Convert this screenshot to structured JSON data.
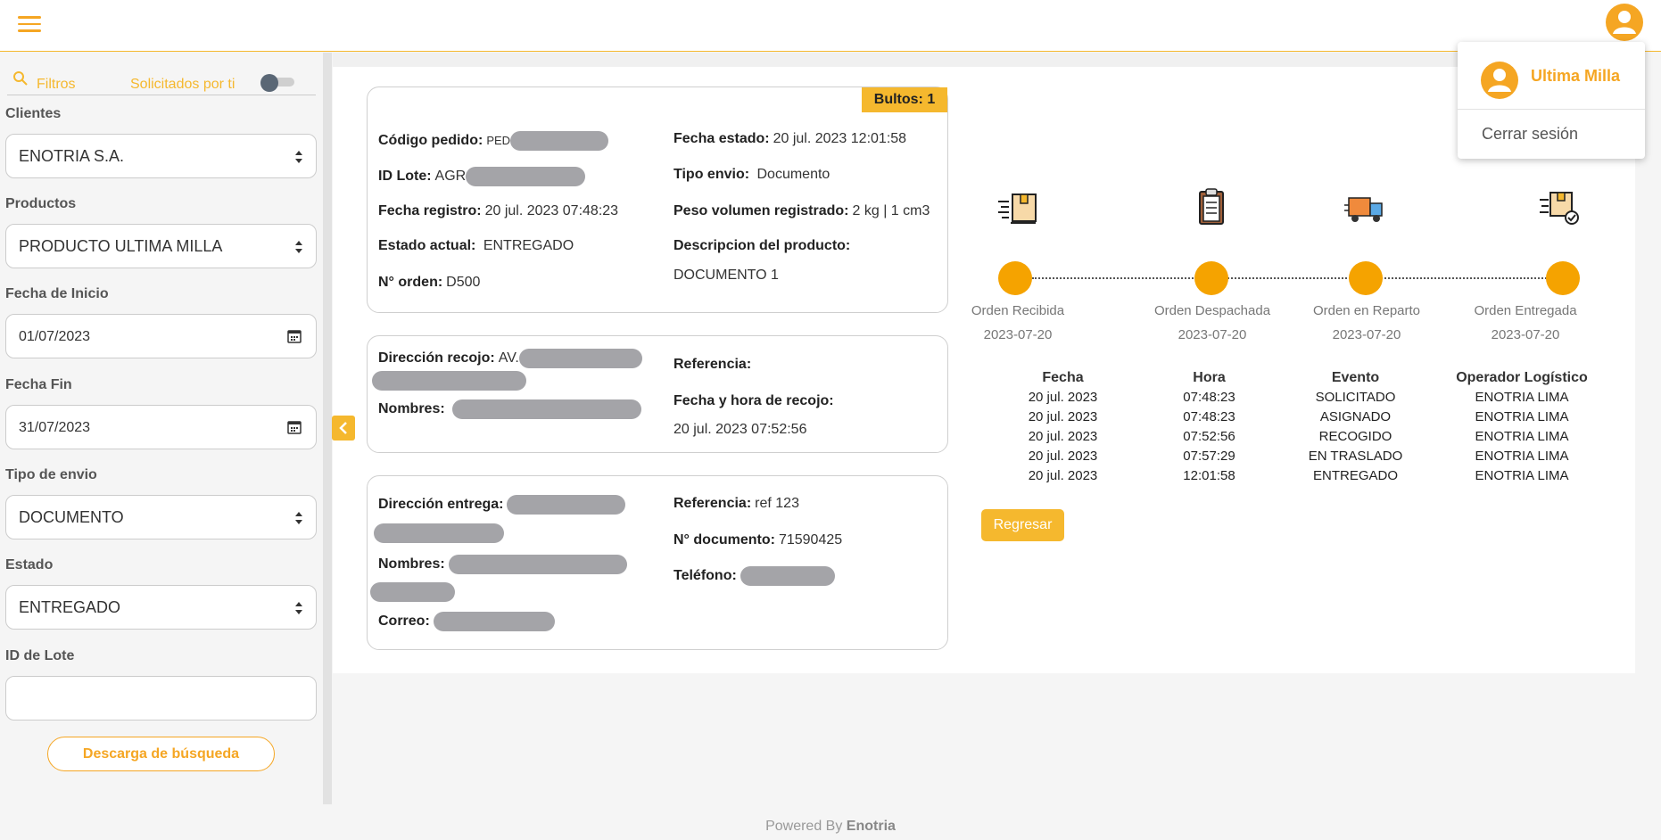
{
  "topbar": {
    "menu_icon": "hamburger-icon",
    "avatar_icon": "user-avatar-icon"
  },
  "sidebar": {
    "filters_label": "Filtros",
    "requested_by_you_label": "Solicitados por ti",
    "fields": {
      "clients": {
        "label": "Clientes",
        "value": "ENOTRIA S.A."
      },
      "products": {
        "label": "Productos",
        "value": "PRODUCTO ULTIMA MILLA"
      },
      "start_date": {
        "label": "Fecha de Inicio",
        "value": "01/07/2023"
      },
      "end_date": {
        "label": "Fecha Fin",
        "value": "31/07/2023"
      },
      "ship_type": {
        "label": "Tipo de envio",
        "value": "DOCUMENTO"
      },
      "status": {
        "label": "Estado",
        "value": "ENTREGADO"
      },
      "batch_id": {
        "label": "ID de Lote",
        "value": ""
      }
    },
    "download_label": "Descarga de búsqueda"
  },
  "order": {
    "bultos": "Bultos: 1",
    "codigo_label": "Código pedido:",
    "codigo_value": "PED",
    "lote_label": "ID Lote:",
    "lote_value": "AGR",
    "registro_label": "Fecha registro:",
    "registro_value": "20 jul. 2023 07:48:23",
    "estado_label": "Estado actual:",
    "estado_value": "ENTREGADO",
    "orden_label": "N° orden:",
    "orden_value": "D500",
    "fecha_estado_label": "Fecha estado:",
    "fecha_estado_value": "20 jul. 2023 12:01:58",
    "tipo_envio_label": "Tipo envio:",
    "tipo_envio_value": "Documento",
    "peso_label": "Peso volumen registrado:",
    "peso_value": "2 kg | 1 cm3",
    "descripcion_label": "Descripcion del producto:",
    "descripcion_value": "DOCUMENTO 1"
  },
  "pickup": {
    "direccion_label": "Dirección recojo:",
    "direccion_value": "AV.",
    "nombres_label": "Nombres:",
    "referencia_label": "Referencia:",
    "fecha_hora_label": "Fecha y hora de recojo:",
    "fecha_hora_value": "20 jul. 2023 07:52:56"
  },
  "delivery": {
    "direccion_label": "Dirección entrega:",
    "nombres_label": "Nombres:",
    "correo_label": "Correo:",
    "referencia_label": "Referencia:",
    "referencia_value": "ref 123",
    "documento_label": "N° documento:",
    "documento_value": "71590425",
    "telefono_label": "Teléfono:"
  },
  "timeline": {
    "steps": [
      {
        "label": "Orden Recibida",
        "date": "2023-07-20",
        "icon": "box-received-icon"
      },
      {
        "label": "Orden Despachada",
        "date": "2023-07-20",
        "icon": "clipboard-icon"
      },
      {
        "label": "Orden en Reparto",
        "date": "2023-07-20",
        "icon": "delivery-truck-icon"
      },
      {
        "label": "Orden Entregada",
        "date": "2023-07-20",
        "icon": "box-delivered-icon"
      }
    ],
    "accent": "#f5a300"
  },
  "events": {
    "headers": [
      "Fecha",
      "Hora",
      "Evento",
      "Operador Logístico"
    ],
    "rows": [
      [
        "20 jul. 2023",
        "07:48:23",
        "SOLICITADO",
        "ENOTRIA LIMA"
      ],
      [
        "20 jul. 2023",
        "07:48:23",
        "ASIGNADO",
        "ENOTRIA LIMA"
      ],
      [
        "20 jul. 2023",
        "07:52:56",
        "RECOGIDO",
        "ENOTRIA LIMA"
      ],
      [
        "20 jul. 2023",
        "07:57:29",
        "EN TRASLADO",
        "ENOTRIA LIMA"
      ],
      [
        "20 jul. 2023",
        "12:01:58",
        "ENTREGADO",
        "ENOTRIA LIMA"
      ]
    ]
  },
  "back_label": "Regresar",
  "user_menu": {
    "name": "Ultima Milla",
    "logout": "Cerrar sesión"
  },
  "footer": {
    "prefix": "Powered By",
    "brand": "Enotria"
  },
  "colors": {
    "accent": "#f5a623",
    "accent_yellow": "#f5b82e"
  }
}
